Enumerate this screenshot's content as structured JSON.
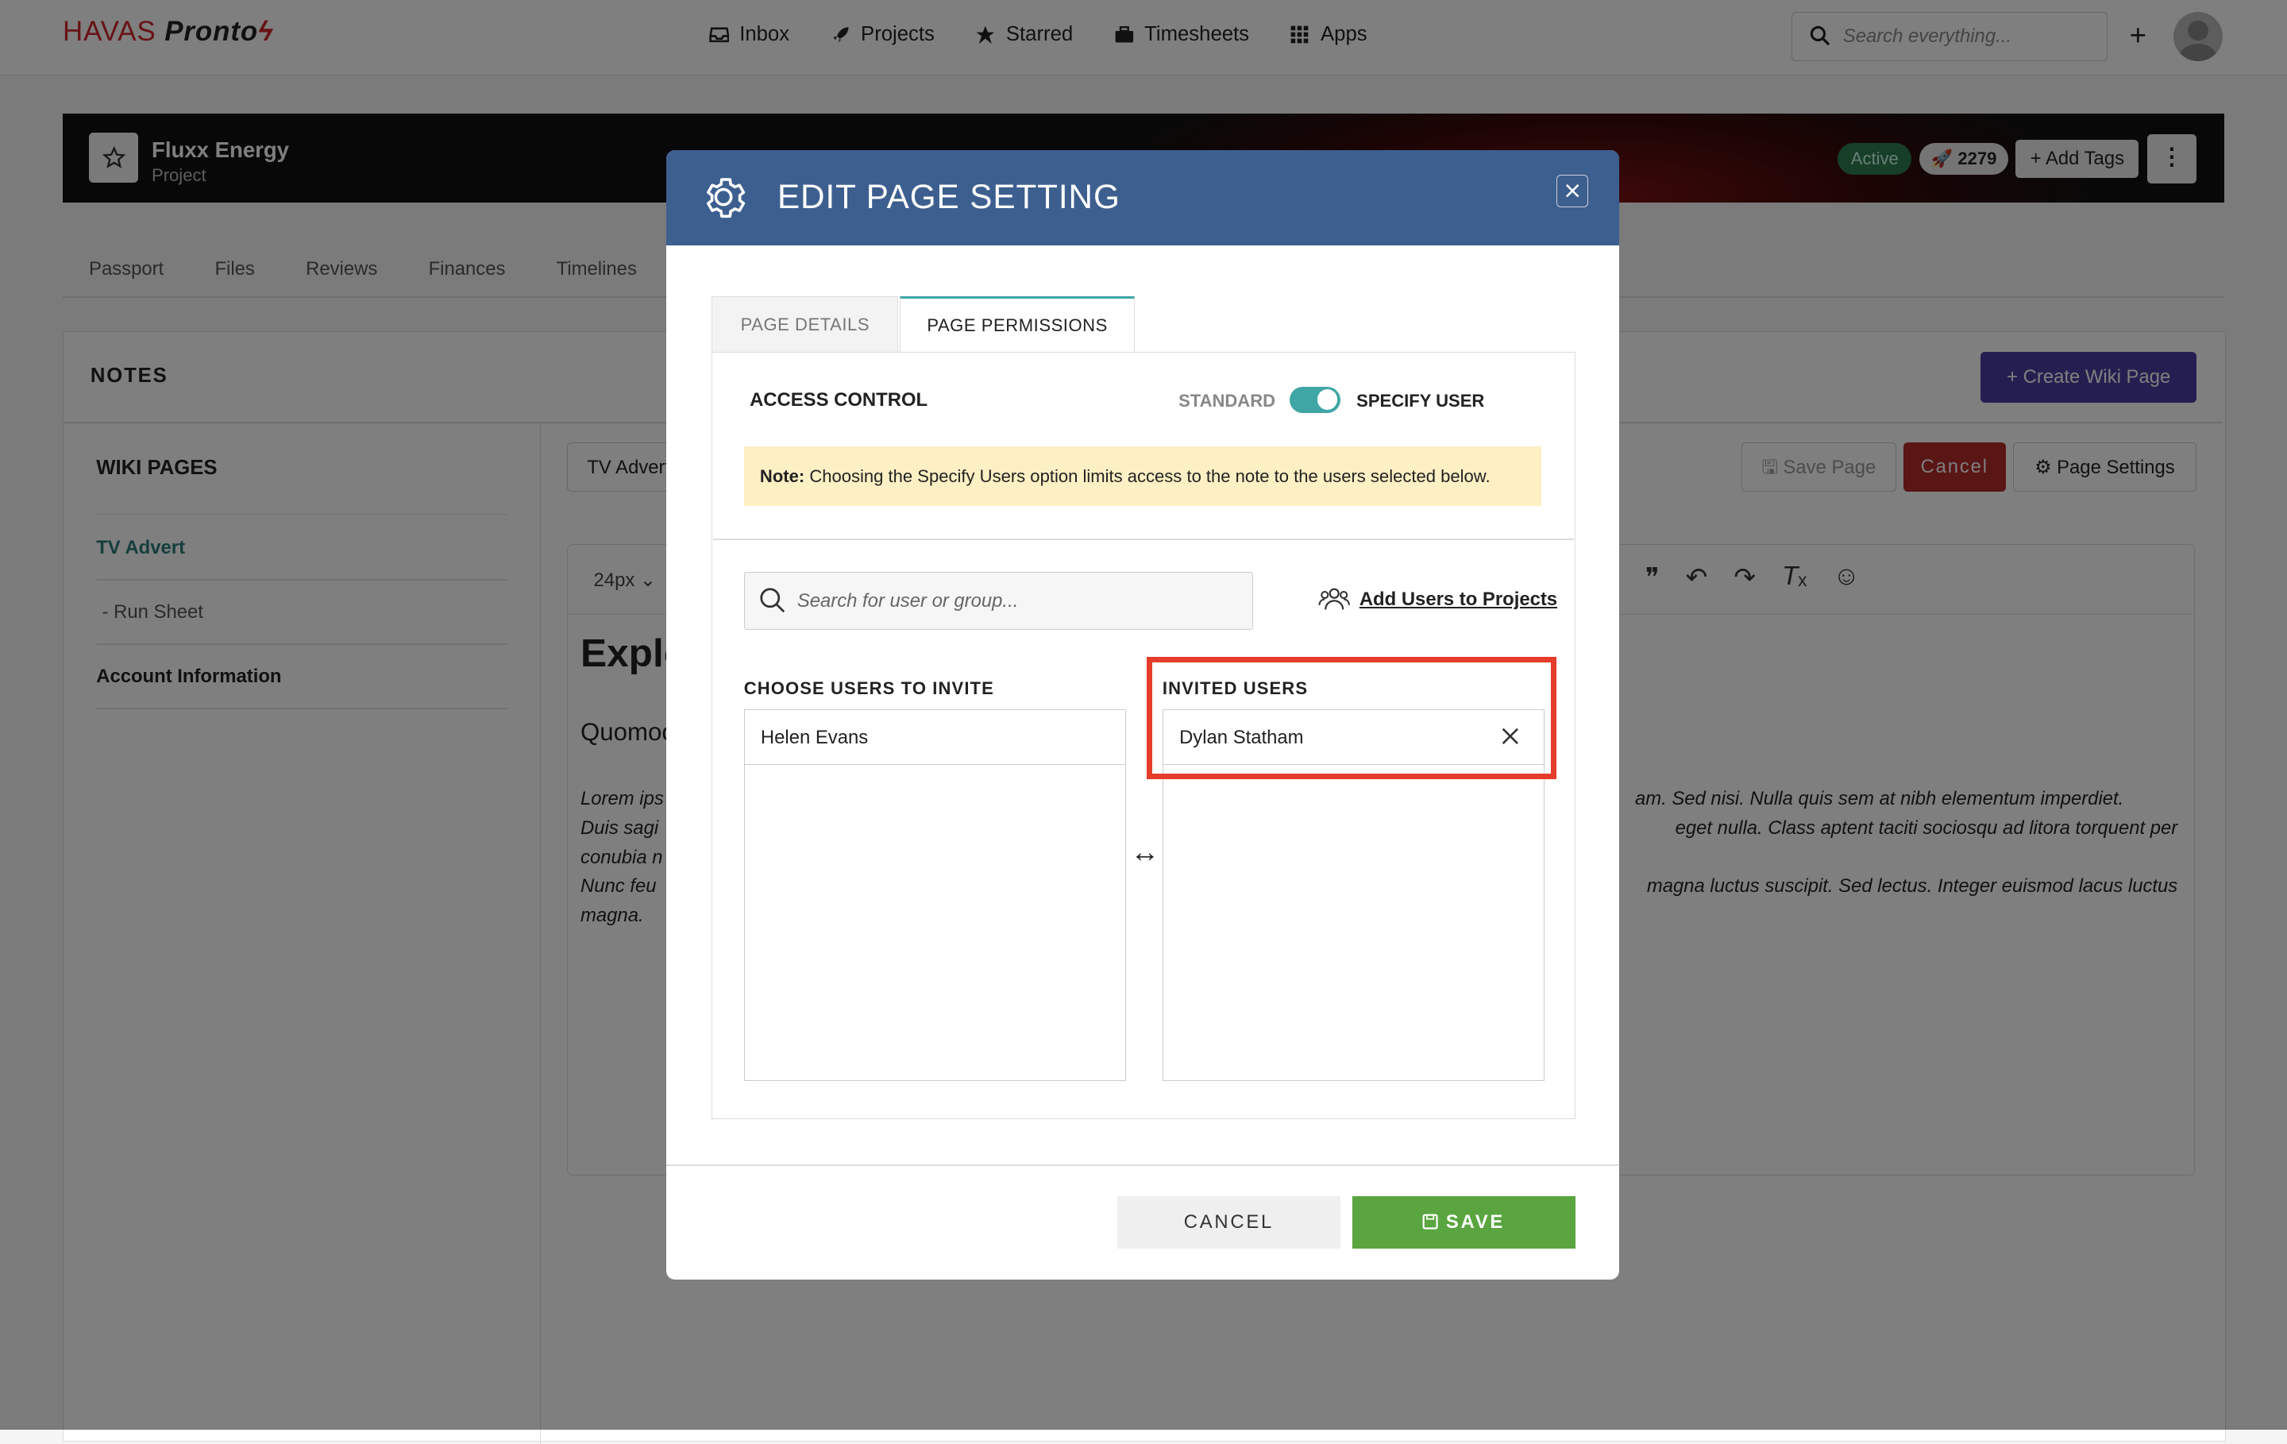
{
  "topnav": {
    "logo_brand": "HAVAS",
    "logo_product": "Pronto",
    "nav": [
      "Inbox",
      "Projects",
      "Starred",
      "Timesheets",
      "Apps"
    ],
    "search_placeholder": "Search everything..."
  },
  "project": {
    "name": "Fluxx Energy",
    "type": "Project",
    "status": "Active",
    "count": "2279",
    "add_tags": "Add Tags"
  },
  "project_tabs": [
    "Passport",
    "Files",
    "Reviews",
    "Finances",
    "Timelines"
  ],
  "notes": {
    "heading": "NOTES",
    "create_button": "Create Wiki Page",
    "sidebar_heading": "WIKI PAGES",
    "sidebar_items": [
      "TV Advert",
      "- Run Sheet",
      "Account Information"
    ],
    "page_name": "TV Advert",
    "save_page": "Save Page",
    "cancel": "Cancel",
    "page_settings": "Page Settings",
    "font_size": "24px",
    "editor_heading": "Explo",
    "editor_subheading": "Quomoc",
    "editor_para_left": [
      "Lorem ips",
      "Duis sagi",
      "conubia n",
      "Nunc feu",
      "magna."
    ],
    "editor_para_right": [
      "am. Sed nisi. Nulla quis sem at nibh elementum imperdiet.",
      "eget nulla. Class aptent taciti sociosqu ad litora torquent per",
      "",
      "magna luctus suscipit. Sed lectus. Integer euismod lacus luctus",
      ""
    ]
  },
  "modal": {
    "title": "EDIT PAGE SETTING",
    "tabs": [
      "PAGE DETAILS",
      "PAGE PERMISSIONS"
    ],
    "active_tab": "PAGE PERMISSIONS",
    "access_control_label": "ACCESS CONTROL",
    "toggle_off_label": "STANDARD",
    "toggle_on_label": "SPECIFY USER",
    "toggle_state": "SPECIFY USER",
    "note_prefix": "Note:",
    "note_text": " Choosing the Specify Users option limits access to the note to the users selected below.",
    "search_placeholder": "Search for user or group...",
    "add_users_link": "Add Users to Projects",
    "choose_heading": "CHOOSE USERS TO INVITE",
    "invited_heading": "INVITED USERS",
    "choose_users": [
      "Helen Evans"
    ],
    "invited_users": [
      "Dylan Statham"
    ],
    "swap_glyph": "↔",
    "cancel_button": "CANCEL",
    "save_button": "SAVE"
  },
  "colors": {
    "modal_header": "#3d5f8f",
    "accent_teal": "#3fa5a5",
    "save_green": "#5aa53f",
    "highlight_red": "#e53c2b",
    "create_purple": "#4a3fa3"
  }
}
